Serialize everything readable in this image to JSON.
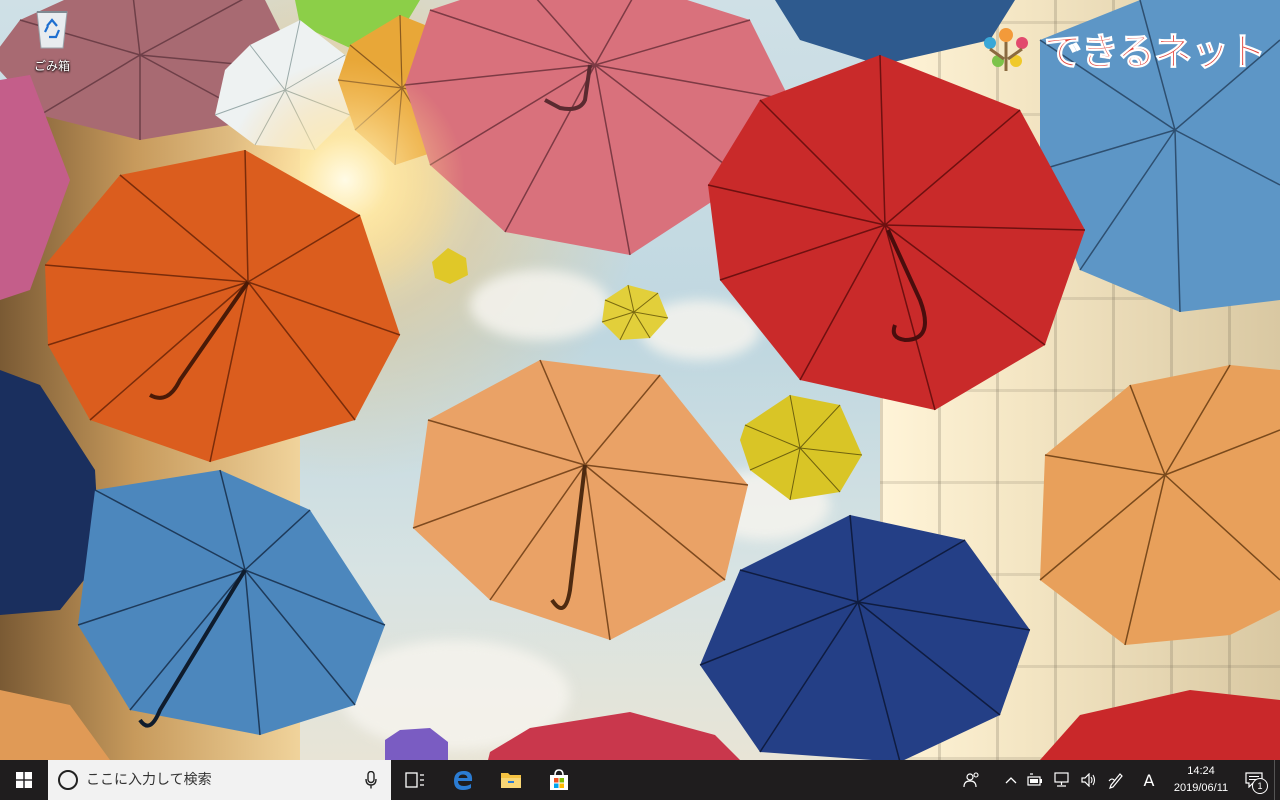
{
  "desktop": {
    "icons": [
      {
        "label": "ごみ箱",
        "icon": "recycle-bin-icon"
      }
    ],
    "wallpaper": "colorful-umbrellas-photo",
    "watermark": {
      "text": "できるネット"
    }
  },
  "taskbar": {
    "start": {
      "icon": "windows-logo-icon"
    },
    "search": {
      "placeholder": "ここに入力して検索",
      "icon": "cortana-ring-icon",
      "mic_icon": "microphone-icon"
    },
    "task_view": {
      "icon": "task-view-icon"
    },
    "pinned": [
      {
        "name": "Microsoft Edge",
        "icon": "edge-icon"
      },
      {
        "name": "エクスプローラー",
        "icon": "file-explorer-icon"
      },
      {
        "name": "Microsoft Store",
        "icon": "store-icon"
      }
    ],
    "tray": {
      "icons": [
        "people-icon",
        "chevron-up-icon",
        "battery-icon",
        "network-icon",
        "volume-icon",
        "pen-icon"
      ],
      "ime": "A",
      "time": "14:24",
      "date": "2019/06/11",
      "notification_count": "1"
    }
  },
  "colors": {
    "taskbar_bg": "#1f1d1e",
    "search_bg": "#f2f2f2",
    "edge_blue": "#2b7cd3",
    "watermark_red": "#e2463e"
  }
}
